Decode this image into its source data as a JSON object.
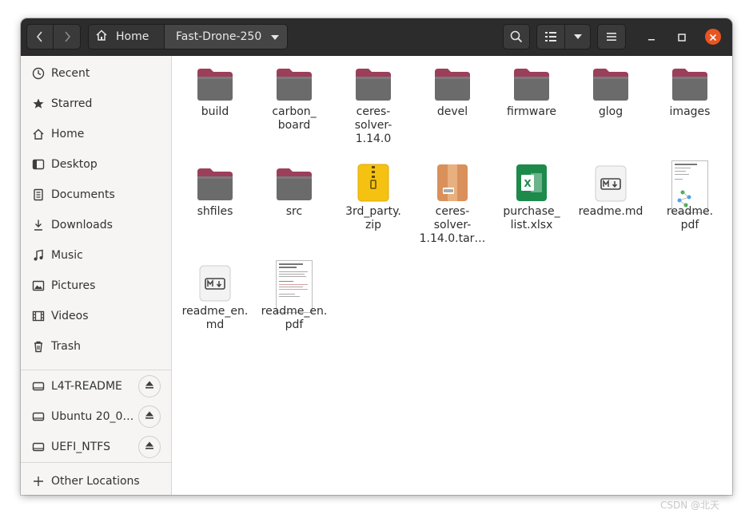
{
  "window": {
    "title_path": {
      "home_label": "Home",
      "current_label": "Fast-Drone-250"
    }
  },
  "icons": {
    "back": "chevron-left-icon",
    "forward": "chevron-right-icon",
    "search": "search-icon",
    "view": "list-view-icon",
    "sort": "triangle-down-icon",
    "menu": "hamburger-icon",
    "minimize": "minimize-icon",
    "maximize": "maximize-icon",
    "close": "close-icon"
  },
  "sidebar": {
    "places": [
      {
        "label": "Recent",
        "icon": "clock-icon"
      },
      {
        "label": "Starred",
        "icon": "star-icon"
      },
      {
        "label": "Home",
        "icon": "home-icon"
      },
      {
        "label": "Desktop",
        "icon": "desktop-icon"
      },
      {
        "label": "Documents",
        "icon": "document-icon"
      },
      {
        "label": "Downloads",
        "icon": "download-icon"
      },
      {
        "label": "Music",
        "icon": "music-icon"
      },
      {
        "label": "Pictures",
        "icon": "picture-icon"
      },
      {
        "label": "Videos",
        "icon": "video-icon"
      },
      {
        "label": "Trash",
        "icon": "trash-icon"
      }
    ],
    "devices": [
      {
        "label": "L4T-README",
        "icon": "drive-icon"
      },
      {
        "label": "Ubuntu 20_0…",
        "icon": "drive-icon"
      },
      {
        "label": "UEFI_NTFS",
        "icon": "drive-icon"
      }
    ],
    "other": {
      "label": "Other Locations",
      "icon": "plus-icon"
    }
  },
  "files": [
    {
      "name": "build",
      "type": "folder"
    },
    {
      "name": "carbon_\nboard",
      "type": "folder"
    },
    {
      "name": "ceres-\nsolver-\n1.14.0",
      "type": "folder"
    },
    {
      "name": "devel",
      "type": "folder"
    },
    {
      "name": "firmware",
      "type": "folder"
    },
    {
      "name": "glog",
      "type": "folder"
    },
    {
      "name": "images",
      "type": "folder"
    },
    {
      "name": "shfiles",
      "type": "folder"
    },
    {
      "name": "src",
      "type": "folder"
    },
    {
      "name": "3rd_party.\nzip",
      "type": "zip"
    },
    {
      "name": "ceres-\nsolver-\n1.14.0.tar…",
      "type": "tar"
    },
    {
      "name": "purchase_\nlist.xlsx",
      "type": "xlsx"
    },
    {
      "name": "readme.md",
      "type": "md"
    },
    {
      "name": "readme.\npdf",
      "type": "pdf"
    },
    {
      "name": "readme_en.\nmd",
      "type": "md"
    },
    {
      "name": "readme_en.\npdf",
      "type": "pdf"
    }
  ],
  "colors": {
    "headerbar": "#2c2c2c",
    "folder_body": "#6b6b6b",
    "folder_tab": "#9c3f5a",
    "accent_close": "#e95420"
  },
  "watermark": "CSDN @北天"
}
